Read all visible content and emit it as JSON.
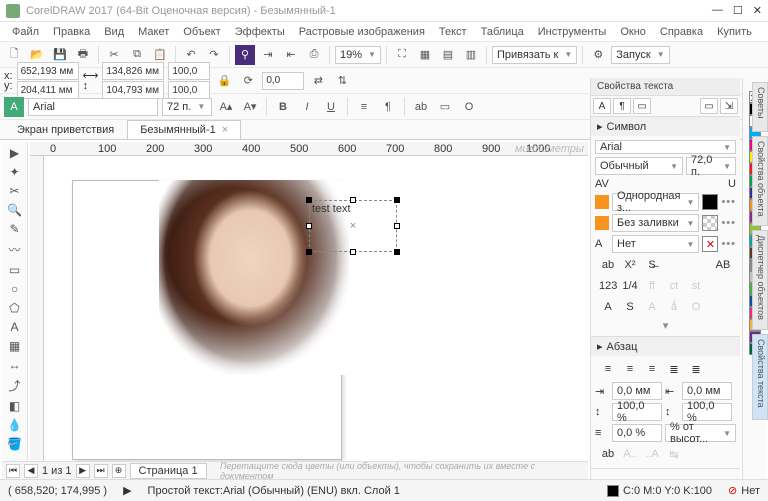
{
  "app": {
    "title": "CorelDRAW 2017 (64-Bit Оценочная версия) - Безымянный-1"
  },
  "menu": [
    "Файл",
    "Правка",
    "Вид",
    "Макет",
    "Объект",
    "Эффекты",
    "Растровые изображения",
    "Текст",
    "Таблица",
    "Инструменты",
    "Окно",
    "Справка",
    "Купить"
  ],
  "toolbar": {
    "zoom": "19%",
    "snap": "Привязать к",
    "launch": "Запуск"
  },
  "prop": {
    "x": "652,193 мм",
    "y": "204,411 мм",
    "w": "134,826 мм",
    "h": "104,793 мм",
    "sx": "100,0",
    "sy": "100,0",
    "rot": "0,0"
  },
  "text": {
    "font": "Arial",
    "size": "72 п.",
    "bold": "B",
    "italic": "I",
    "underline": "U"
  },
  "tabs": {
    "welcome": "Экран приветствия",
    "doc": "Безымянный-1"
  },
  "ruler": [
    "0",
    "100",
    "200",
    "300",
    "400",
    "500",
    "600",
    "700",
    "800",
    "900",
    "1000"
  ],
  "ruler_units": "миллиметры",
  "canvas": {
    "sampletext": "test text"
  },
  "dock": {
    "title": "Свойства текста",
    "section_symbol": "Символ",
    "font": "Arial",
    "style": "Обычный",
    "size": "72,0 п.",
    "fill": "Однородная з...",
    "nofill": "Без заливки",
    "outline": "Нет",
    "section_para": "Абзац",
    "indent": "0,0 мм",
    "indent2": "0,0 мм",
    "scale1": "100,0 %",
    "scale2": "100,0 %",
    "sp1": "0,0 %",
    "sp2": "% от высот..."
  },
  "pagebar": {
    "page": "1 из 1",
    "tab": "Страница 1"
  },
  "hint": "Перетащите сюда цветы (или объекты), чтобы сохранить их вместе с документом",
  "status": {
    "coords": "( 658,520; 174,995 )",
    "obj": "Простой текст:Arial (Обычный) (ENU) вкл. Слой 1",
    "color": "C:0 M:0 Y:0 K:100",
    "outline": "Нет"
  },
  "vtabs": [
    "Советы",
    "Свойства объекта",
    "Диспетчер объектов",
    "Свойства текста"
  ],
  "colors": [
    "#000",
    "#fff",
    "#00aeef",
    "#ec008c",
    "#fff200",
    "#ed1c24",
    "#00a651",
    "#2e3192",
    "#f7941d",
    "#92278f",
    "#8dc63f",
    "#00a99d",
    "#603913",
    "#898989",
    "#c0c0c0",
    "#39b54a",
    "#0054a6",
    "#ee2a7b",
    "#fbb040",
    "#662d91",
    "#006838"
  ]
}
